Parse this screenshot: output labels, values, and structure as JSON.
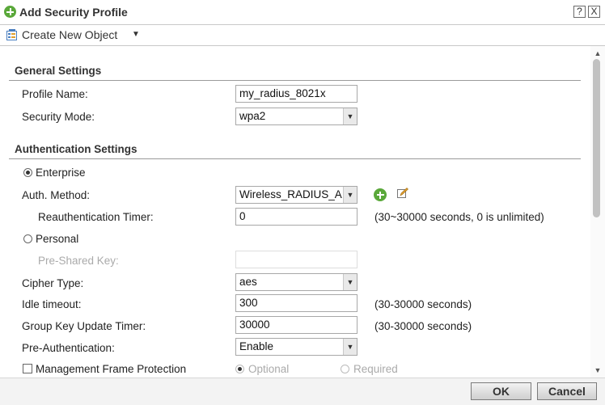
{
  "dialog": {
    "title": "Add Security Profile",
    "help_label": "?",
    "close_label": "X"
  },
  "toolbar": {
    "create_label": "Create New Object"
  },
  "general": {
    "heading": "General Settings",
    "profile_name_label": "Profile Name:",
    "profile_name_value": "my_radius_8021x",
    "security_mode_label": "Security Mode:",
    "security_mode_value": "wpa2"
  },
  "auth": {
    "heading": "Authentication Settings",
    "enterprise_label": "Enterprise",
    "auth_method_label": "Auth. Method:",
    "auth_method_value": "Wireless_RADIUS_A",
    "reauth_label": "Reauthentication Timer:",
    "reauth_value": "0",
    "reauth_hint": "(30~30000 seconds, 0 is unlimited)",
    "personal_label": "Personal",
    "psk_label": "Pre-Shared Key:",
    "psk_value": "",
    "cipher_label": "Cipher Type:",
    "cipher_value": "aes",
    "idle_label": "Idle timeout:",
    "idle_value": "300",
    "idle_hint": "(30-30000 seconds)",
    "gku_label": "Group Key Update Timer:",
    "gku_value": "30000",
    "gku_hint": "(30-30000 seconds)",
    "preauth_label": "Pre-Authentication:",
    "preauth_value": "Enable",
    "mfp_label": "Management Frame Protection",
    "mfp_optional": "Optional",
    "mfp_required": "Required"
  },
  "footer": {
    "ok_label": "OK",
    "cancel_label": "Cancel"
  },
  "colors": {
    "accent_green": "#5aa83a",
    "section_line": "#9a9a9a"
  }
}
